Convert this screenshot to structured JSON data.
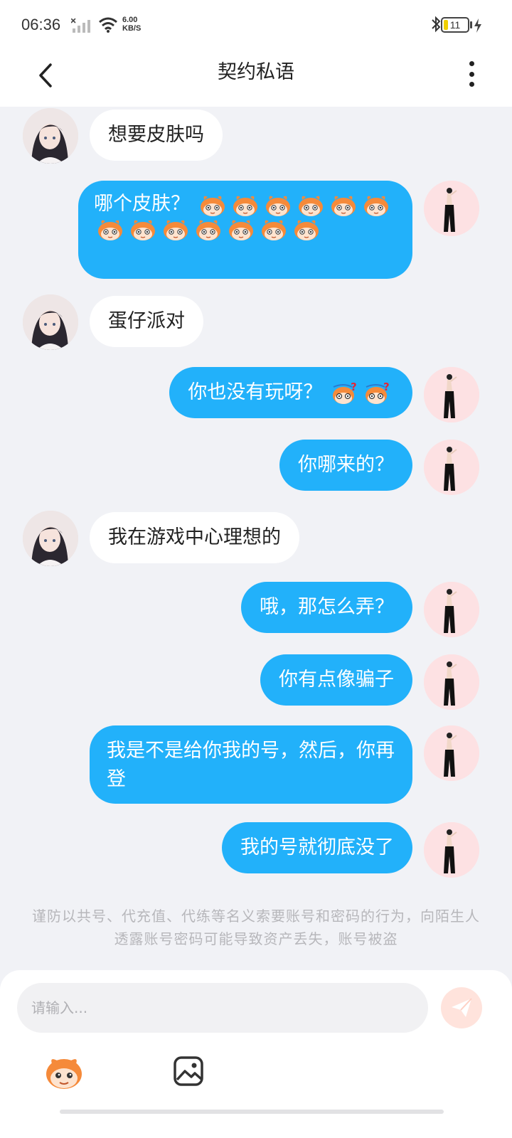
{
  "status_bar": {
    "time": "06:36",
    "net_speed_value": "6.00",
    "net_speed_unit": "KB/S",
    "battery": "11"
  },
  "header": {
    "title": "契约私语"
  },
  "messages": [
    {
      "from": "her",
      "text": "想要皮肤吗"
    },
    {
      "from": "me",
      "text": "哪个皮肤？",
      "emoji_count": 13
    },
    {
      "from": "her",
      "text": "蛋仔派对"
    },
    {
      "from": "me",
      "text": "你也没有玩呀？",
      "emoji_count": 2
    },
    {
      "from": "me",
      "text": "你哪来的？"
    },
    {
      "from": "her",
      "text": "我在游戏中心理想的"
    },
    {
      "from": "me",
      "text": "哦，那怎么弄？"
    },
    {
      "from": "me",
      "text": "你有点像骗子"
    },
    {
      "from": "me",
      "text": "我是不是给你我的号，然后，你再登"
    },
    {
      "from": "me",
      "text": "我的号就彻底没了"
    }
  ],
  "notice": "谨防以共号、代充值、代练等名义索要账号和密码的行为，向陌生人透露账号密码可能导致资产丢失，账号被盗",
  "input": {
    "placeholder": "请输入..."
  },
  "colors": {
    "outgoing_bubble": "#22b1fa",
    "incoming_bubble": "#ffffff",
    "background": "#f1f2f6",
    "send_button": "#ffe3dc"
  },
  "icons": [
    "back-arrow-icon",
    "more-vertical-icon",
    "send-icon",
    "eggy-emoji-icon",
    "image-icon"
  ]
}
